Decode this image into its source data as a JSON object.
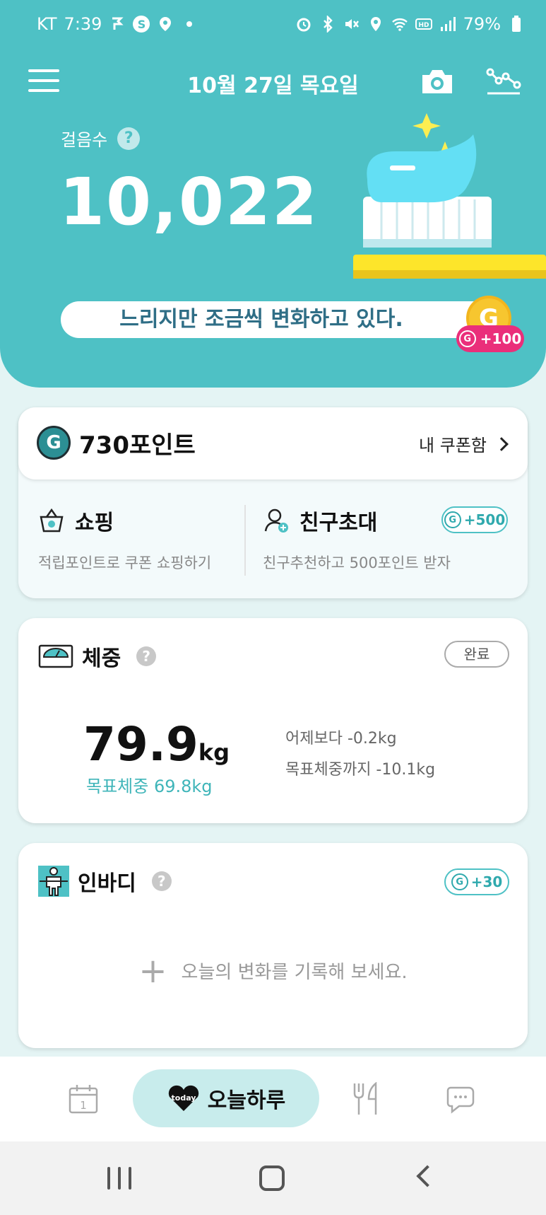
{
  "statusbar": {
    "carrier": "KT",
    "time": "7:39",
    "battery": "79%"
  },
  "header": {
    "date": "10월 27일 목요일",
    "steps_label": "걸음수",
    "steps_value": "10,022",
    "message": "느리지만 조금씩 변화하고 있다.",
    "coin_letter": "G",
    "coin_reward": "+100"
  },
  "points": {
    "logo_letter": "G",
    "value": "730포인트",
    "coupon_label": "내 쿠폰함",
    "shop_title": "쇼핑",
    "shop_desc": "적립포인트로 쿠폰 쇼핑하기",
    "invite_title": "친구초대",
    "invite_desc": "친구추천하고 500포인트 받자",
    "invite_reward": "+500"
  },
  "weight": {
    "title": "체중",
    "status": "완료",
    "value": "79.9",
    "unit": "kg",
    "goal": "목표체중 69.8kg",
    "diff": "어제보다 -0.2kg",
    "to_goal": "목표체중까지 -10.1kg"
  },
  "inbody": {
    "title": "인바디",
    "reward": "+30",
    "empty_message": "오늘의 변화를 기록해 보세요."
  },
  "bottom_nav": {
    "calendar_day": "1",
    "today_badge": "today",
    "today_label": "오늘하루"
  },
  "colors": {
    "brand": "#4ec1c5",
    "accent_pink": "#ea2f7a",
    "coin_gold": "#f7c62f"
  },
  "icons": [
    "menu-icon",
    "camera-icon",
    "graph-icon",
    "question-icon",
    "g-coin-icon",
    "basket-icon",
    "add-friend-icon",
    "scale-icon",
    "body-icon",
    "calendar-icon",
    "heart-icon",
    "food-icon",
    "chat-icon"
  ]
}
